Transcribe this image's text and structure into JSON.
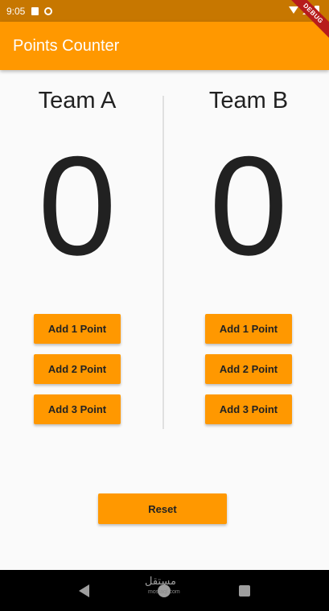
{
  "status_bar": {
    "time": "9:05",
    "icons": [
      "sim-icon",
      "sync-icon",
      "wifi-icon",
      "signal-icon",
      "battery-icon"
    ]
  },
  "debug_banner": "DEBUG",
  "app_bar": {
    "title": "Points Counter",
    "color": "#ff9800"
  },
  "teams": [
    {
      "name": "Team A",
      "score": "0",
      "buttons": [
        "Add 1 Point",
        "Add 2 Point",
        "Add 3 Point"
      ]
    },
    {
      "name": "Team B",
      "score": "0",
      "buttons": [
        "Add 1 Point",
        "Add 2 Point",
        "Add 3 Point"
      ]
    }
  ],
  "reset_label": "Reset",
  "nav_bar": {
    "icons": [
      "back-icon",
      "home-icon",
      "recent-apps-icon"
    ]
  },
  "watermark": {
    "text": "مستقل",
    "sub": "mostaql.com"
  }
}
